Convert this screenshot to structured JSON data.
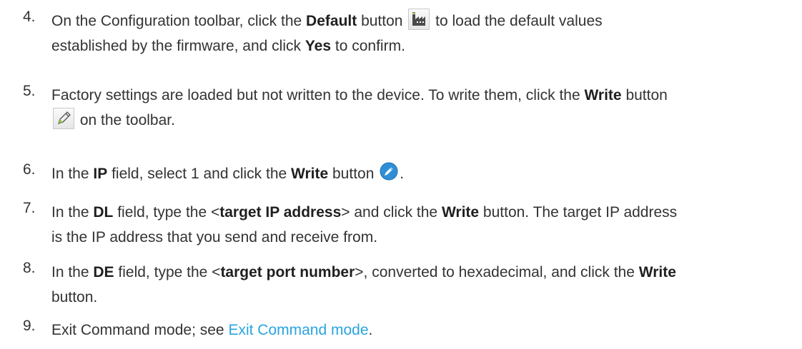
{
  "steps": [
    {
      "number": "4.",
      "t1": "On the Configuration toolbar, click the ",
      "b1": "Default",
      "t2": " button ",
      "t3": " to load the default values",
      "t4": "established by the firmware, and click ",
      "b2": "Yes",
      "t5": " to confirm."
    },
    {
      "number": "5.",
      "t1": "Factory settings are loaded but not written to the device. To write them, click the ",
      "b1": "Write",
      "t2": " button",
      "t3": " on the toolbar."
    },
    {
      "number": "6.",
      "t1": "In the ",
      "b1": "IP",
      "t2": " field, select 1 and click the ",
      "b2": "Write",
      "t3": " button ",
      "t4": "."
    },
    {
      "number": "7.",
      "t1": "In the ",
      "b1": "DL",
      "t2": " field, type the <",
      "b2": "target IP address",
      "t3": "> and click the ",
      "b3": "Write",
      "t4": " button. The target IP address",
      "t5": "is the IP address that you send and receive from."
    },
    {
      "number": "8.",
      "t1": "In the ",
      "b1": "DE",
      "t2": " field, type the <",
      "b2": "target port number",
      "t3": ">, converted to hexadecimal, and click the ",
      "b3": "Write",
      "t4": "button."
    },
    {
      "number": "9.",
      "t1": "Exit Command mode; see ",
      "link": "Exit Command mode",
      "t2": "."
    }
  ],
  "icons": {
    "default": "factory-icon",
    "write_toolbar": "pencil-icon",
    "write_round": "pencil-circle-icon"
  },
  "colors": {
    "text": "#333333",
    "link": "#2aa4e0"
  }
}
